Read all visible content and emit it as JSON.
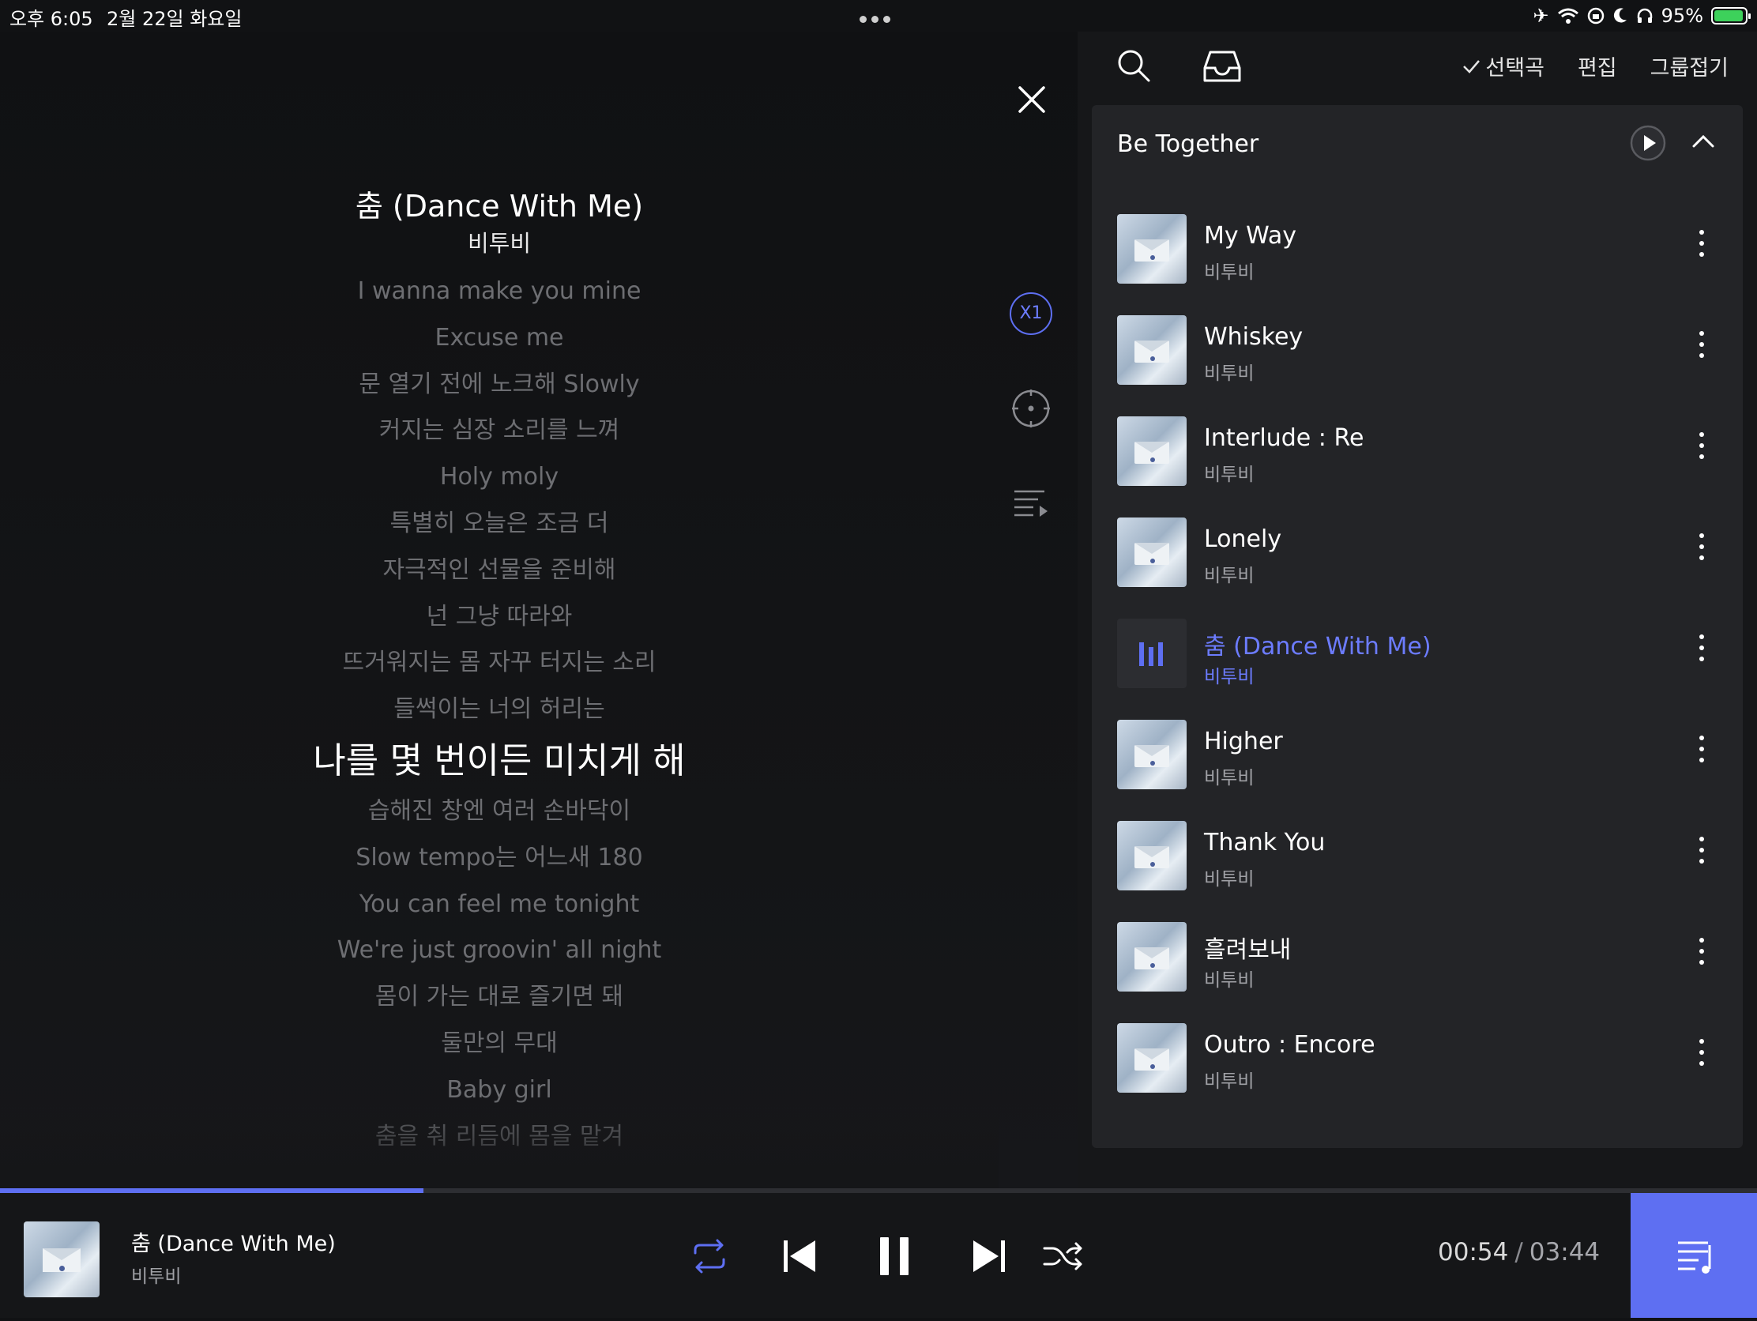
{
  "status_bar": {
    "time": "오후 6:05",
    "date": "2월 22일 화요일",
    "battery": "95%",
    "icons": [
      "airplane-icon",
      "wifi-icon",
      "orientation-lock-icon",
      "moon-icon",
      "headphones-icon",
      "battery-icon"
    ]
  },
  "now_playing": {
    "title": "춤 (Dance With Me)",
    "artist": "비투비",
    "speed_label": "X1"
  },
  "lyrics": [
    "I wanna make you mine",
    "Excuse me",
    "문 열기 전에 노크해 Slowly",
    "커지는 심장 소리를 느껴",
    "Holy moly",
    "특별히 오늘은 조금 더",
    "자극적인 선물을 준비해",
    "넌 그냥 따라와",
    "뜨거워지는 몸 자꾸 터지는 소리",
    "들썩이는 너의 허리는",
    "나를 몇 번이든 미치게 해",
    "습해진 창엔 여러 손바닥이",
    "Slow tempo는 어느새 180",
    "You can feel me tonight",
    "We're just groovin' all night",
    "몸이 가는 대로 즐기면 돼",
    "둘만의 무대",
    "Baby girl",
    "춤을 춰 리듬에 몸을 맡겨"
  ],
  "current_lyric_index": 10,
  "playlist_toolbar": {
    "select_label": "선택곡",
    "edit_label": "편집",
    "fold_label": "그룹접기"
  },
  "group": {
    "title": "Be Together",
    "tracks": [
      {
        "title": "My Way",
        "artist": "비투비",
        "playing": false
      },
      {
        "title": "Whiskey",
        "artist": "비투비",
        "playing": false
      },
      {
        "title": "Interlude : Re",
        "artist": "비투비",
        "playing": false
      },
      {
        "title": "Lonely",
        "artist": "비투비",
        "playing": false
      },
      {
        "title": "춤 (Dance With Me)",
        "artist": "비투비",
        "playing": true
      },
      {
        "title": "Higher",
        "artist": "비투비",
        "playing": false
      },
      {
        "title": "Thank You",
        "artist": "비투비",
        "playing": false
      },
      {
        "title": "흘려보내",
        "artist": "비투비",
        "playing": false
      },
      {
        "title": "Outro : Encore",
        "artist": "비투비",
        "playing": false
      }
    ]
  },
  "player": {
    "title": "춤 (Dance With Me)",
    "artist": "비투비",
    "elapsed": "00:54",
    "separator": "/",
    "duration": "03:44",
    "progress_fraction": 0.241
  },
  "colors": {
    "accent": "#5e6ff2",
    "background": "#111214",
    "panel": "#232427"
  }
}
